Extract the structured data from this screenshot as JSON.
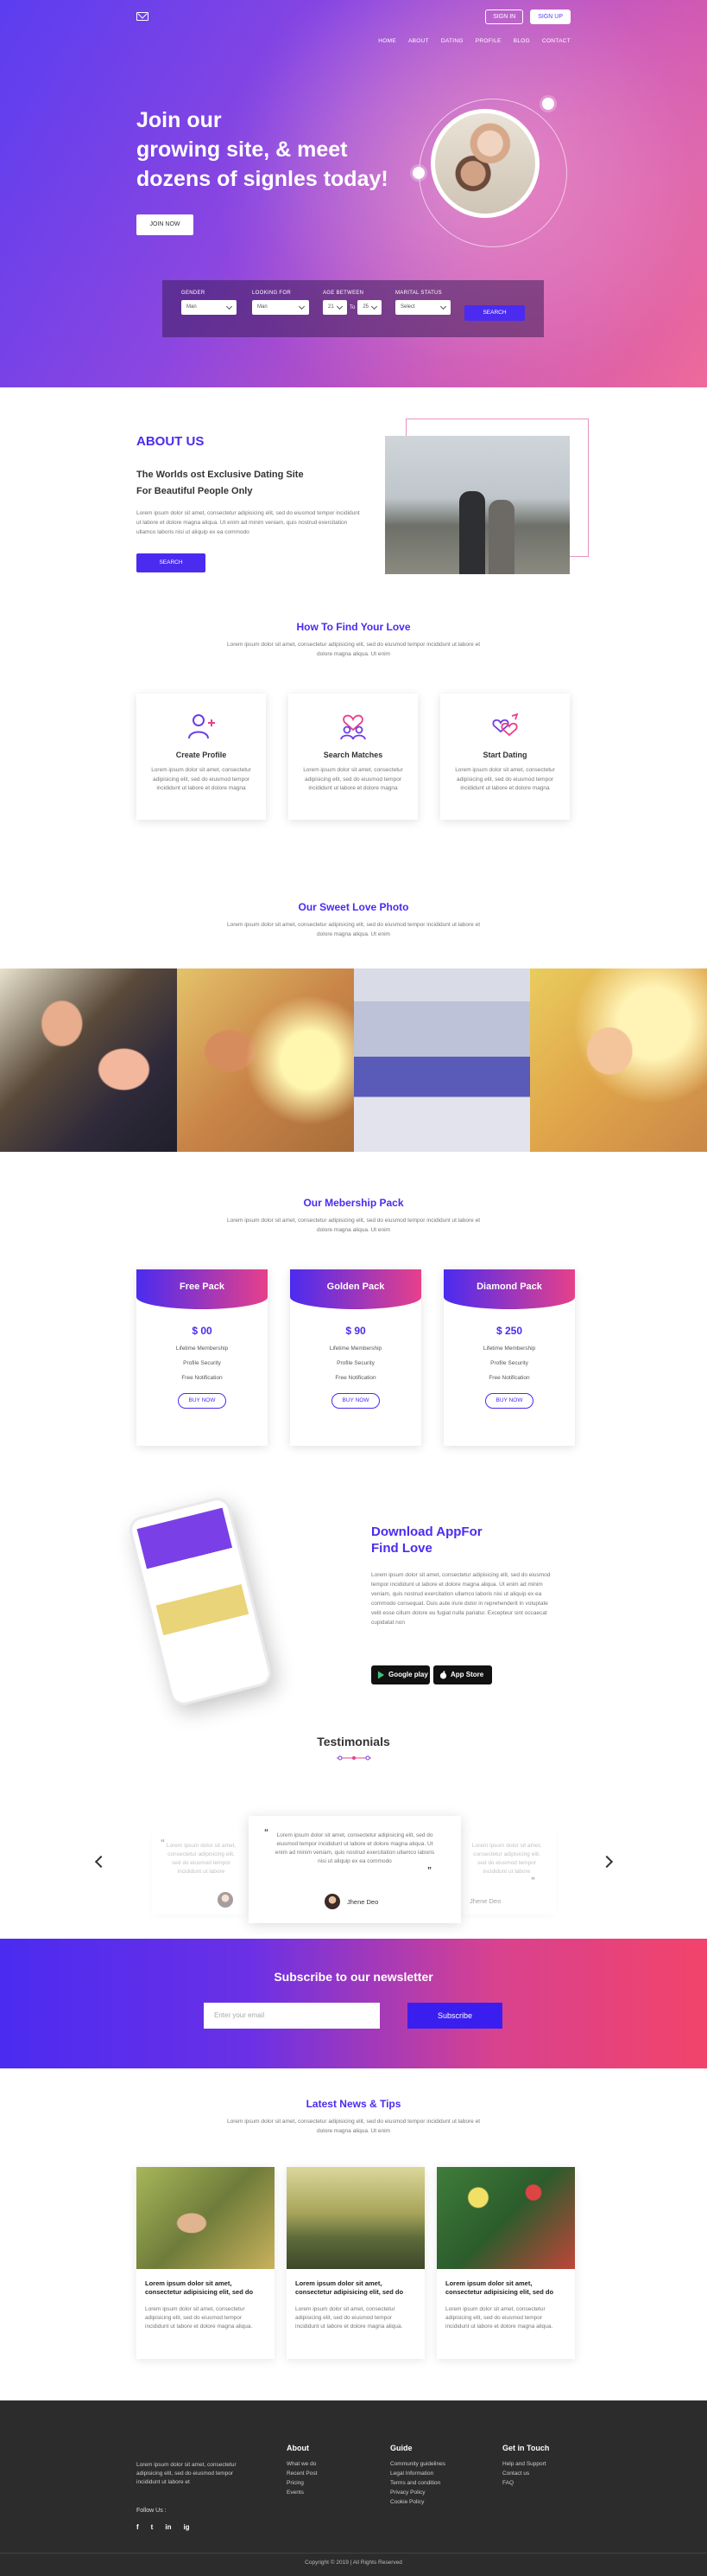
{
  "header": {
    "signin": "SIGN IN",
    "signup": "SIGN UP",
    "nav": [
      "HOME",
      "ABOUT",
      "DATING",
      "PROFILE",
      "BLOG",
      "CONTACT"
    ]
  },
  "hero": {
    "title_line1": "Join our",
    "title_line2": "growing site, & meet",
    "title_line3": "dozens of signles today!",
    "button": "JOIN NOW"
  },
  "search": {
    "fields": [
      {
        "label": "GENDER",
        "value": "Man"
      },
      {
        "label": "LOOKING FOR",
        "value": "Man"
      },
      {
        "label": "AGE BETWEEN",
        "from": "21",
        "to_word": "To",
        "to": "25"
      },
      {
        "label": "MARITAL STATUS",
        "value": "Select"
      }
    ],
    "button": "SEARCH"
  },
  "about": {
    "title": "ABOUT US",
    "subtitle_line1": "The Worlds ost Exclusive Dating Site",
    "subtitle_line2": "For Beautiful People Only",
    "text": "Lorem ipsum dolor sit amet, consectetur adipisicing elit, sed do eiusmod tempor incididunt ut labore et dolore magna aliqua. Ut enim ad minim veniam, quis nostrud exercitation ullamco laboris nisi ut aliquip ex ea commodo",
    "button": "SEARCH"
  },
  "find": {
    "title": "How To Find Your Love",
    "intro": "Lorem ipsum dolor sit amet, consectetur adipisicing elit, sed do eiusmod tempor incididunt ut labore et dolore magna aliqua. Ut enim",
    "cards": [
      {
        "title": "Create Profile",
        "text": "Lorem ipsum dolor sit amet, consectetur adipisicing elit, sed do eiusmod tempor incididunt ut labore et dolore magna",
        "icon": "add-user-icon"
      },
      {
        "title": "Search Matches",
        "text": "Lorem ipsum dolor sit amet, consectetur adipisicing elit, sed do eiusmod tempor incididunt ut labore et dolore magna",
        "icon": "couple-hearts-icon"
      },
      {
        "title": "Start Dating",
        "text": "Lorem ipsum dolor sit amet, consectetur adipisicing elit, sed do eiusmod tempor incididunt ut labore et dolore magna",
        "icon": "linked-hearts-icon"
      }
    ]
  },
  "photos": {
    "title": "Our Sweet Love Photo",
    "intro": "Lorem ipsum dolor sit amet, consectetur adipisicing elit, sed do eiusmod tempor incididunt ut labore et dolore magna aliqua. Ut enim"
  },
  "packs": {
    "title": "Our Mebership Pack",
    "intro": "Lorem ipsum dolor sit amet, consectetur adipisicing elit, sed do eiusmod tempor incididunt ut labore et dolore magna aliqua. Ut enim",
    "cards": [
      {
        "name": "Free Pack",
        "price": "$ 00"
      },
      {
        "name": "Golden Pack",
        "price": "$ 90"
      },
      {
        "name": "Diamond Pack",
        "price": "$ 250"
      }
    ],
    "features": [
      "Lifetime Membership",
      "Profile Security",
      "Free Notification"
    ],
    "button": "BUY NOW"
  },
  "app": {
    "title_line1": "Download AppFor",
    "title_line2": "Find Love",
    "text": "Lorem ipsum dolor sit amet, consectetur adipisicing elit, sed do eiusmod tempor incididunt ut labore et dolore magna aliqua. Ut enim ad minim veniam, quis nostrud exercitation ullamco laboris nisi ut aliquip ex ea commodo consequat. Duis aute irure dolor in reprehenderit in voluptate velit esse cillum dolore eu fugiat nulla pariatur. Excepteur sint occaecat cupidatat non",
    "google": "Google play",
    "apple": "App Store"
  },
  "testimonials": {
    "title": "Testimonials",
    "quote": "Lorem ipsum dolor sit amet, consectetur adipisicing elit, sed do eiusmod tempor incididunt ut labore et dolore magna aliqua. Ut enim ad minim veniam, quis nostrud exercitation ullamco laboris nisi ut aliquip ex ea commodo",
    "side_quote": "Lorem ipsum dolor sit amet, consectetur adipisicing elit, sed do eiusmod tempor incididunt ut labore",
    "name": "Jhene Deo"
  },
  "newsletter": {
    "title": "Subscribe to our newsletter",
    "placeholder": "Enter your email",
    "button": "Subscribe"
  },
  "latest": {
    "title": "Latest News & Tips",
    "intro": "Lorem ipsum dolor sit amet, consectetur adipisicing elit, sed do eiusmod tempor incididunt ut labore et dolore magna aliqua. Ut enim",
    "cards": [
      {
        "title": "Lorem ipsum dolor sit amet, consectetur adipisicing elit, sed do",
        "text": "Lorem ipsum dolor sit amet, consectetur adipisicing elit, sed do eiusmod tempor incididunt ut labore et dolore magna aliqua."
      },
      {
        "title": "Lorem ipsum dolor sit amet, consectetur adipisicing elit, sed do",
        "text": "Lorem ipsum dolor sit amet, consectetur adipisicing elit, sed do eiusmod tempor incididunt ut labore et dolore magna aliqua."
      },
      {
        "title": "Lorem ipsum dolor sit amet, consectetur adipisicing elit, sed do",
        "text": "Lorem ipsum dolor sit amet, consectetur adipisicing elit, sed do eiusmod tempor incididunt ut labore et dolore magna aliqua."
      }
    ]
  },
  "footer": {
    "about_text": "Lorem ipsum dolor sit amet, consectetur adipisicing elit, sed do eiusmod tempor incididunt ut labore et",
    "follow": "Follow Us :",
    "social": [
      "f",
      "t",
      "in",
      "ig"
    ],
    "cols": [
      {
        "title": "About",
        "links": [
          "What we do",
          "Recent Post",
          "Pricing",
          "Events"
        ]
      },
      {
        "title": "Guide",
        "links": [
          "Community guidelines",
          "Legal Information",
          "Terms and condition",
          "Privacy Policy",
          "Cookie Policy"
        ]
      },
      {
        "title": "Get in Touch",
        "links": [
          "Help and Support",
          "Contact us",
          "FAQ"
        ]
      }
    ],
    "copyright": "Copyright © 2019 | All Rights Reserved"
  },
  "colors": {
    "primary": "#4b2bf0",
    "accent": "#e7408a",
    "footer": "#2c2c2c"
  }
}
